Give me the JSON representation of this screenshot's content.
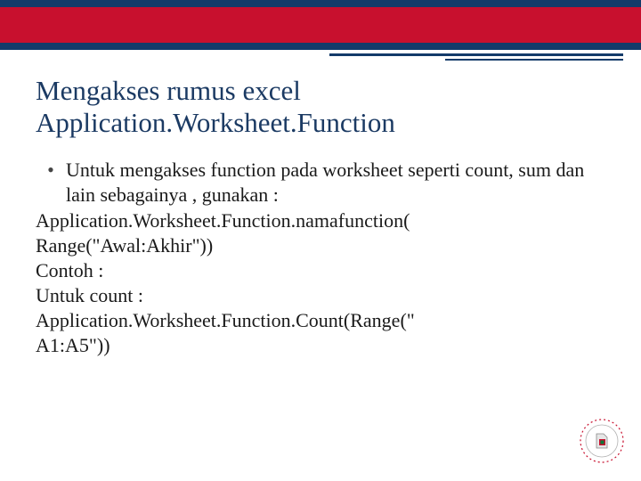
{
  "header": {
    "title_line1": "Mengakses rumus excel",
    "title_line2": "Application.Worksheet.Function"
  },
  "bullet": {
    "marker": "•",
    "text": "Untuk mengakses function pada worksheet seperti count, sum dan lain sebagainya , gunakan :"
  },
  "lines": {
    "l1": "Application.Worksheet.Function.namafunction(",
    "l2": "Range(\"Awal:Akhir\"))",
    "l3": "Contoh :",
    "l4": "Untuk count :",
    "l5": "Application.Worksheet.Function.Count(Range(\"",
    "l6": "A1:A5\"))"
  },
  "logo": {
    "name": "university-logo"
  }
}
